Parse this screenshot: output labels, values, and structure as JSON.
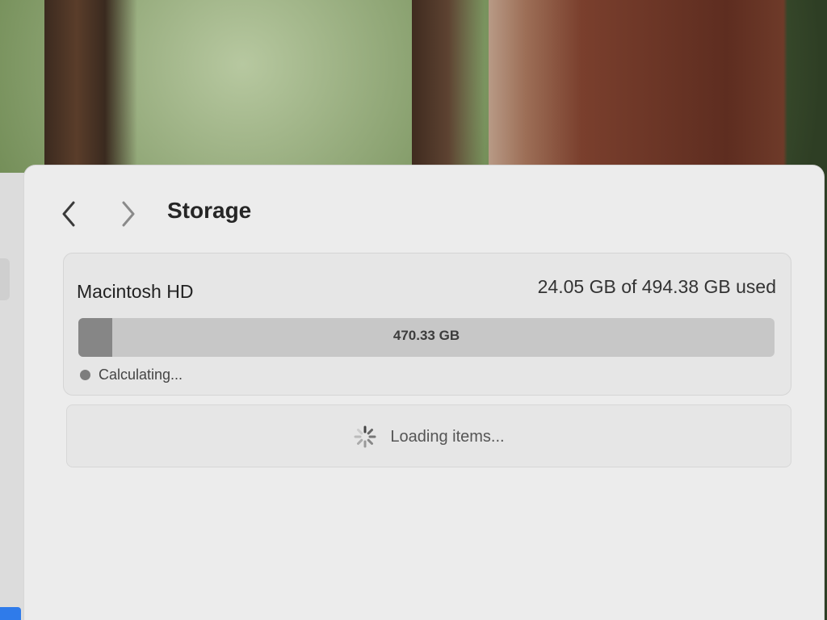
{
  "header": {
    "title": "Storage"
  },
  "disk": {
    "name": "Macintosh HD",
    "usage_text": "24.05 GB of 494.38 GB used",
    "available_label": "470.33 GB",
    "used_fraction": 0.0486,
    "legend_label": "Calculating..."
  },
  "items": {
    "loading_text": "Loading items..."
  },
  "icons": {
    "back": "chevron-left-icon",
    "forward": "chevron-right-icon",
    "spinner": "spinner-icon"
  },
  "colors": {
    "used_segment": "#868686",
    "bar_background": "#c7c7c7",
    "selection_accent": "#2f7bea"
  }
}
